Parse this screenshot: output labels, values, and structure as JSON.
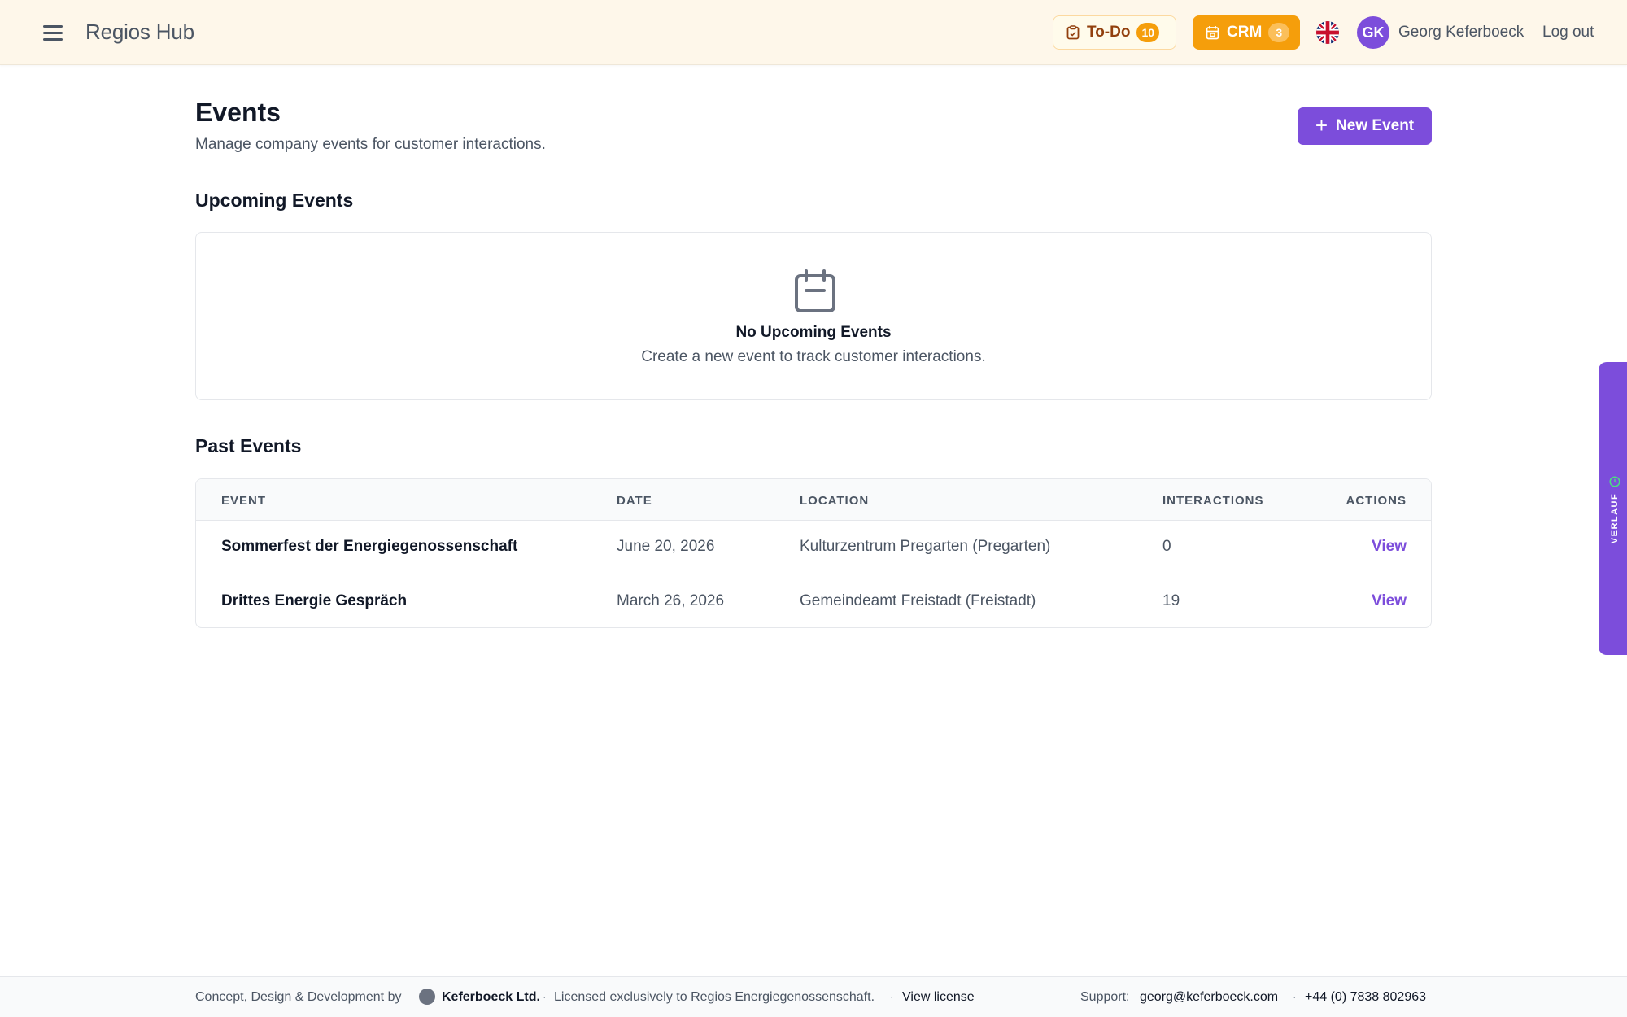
{
  "header": {
    "brand": "Regios Hub",
    "todo": {
      "label": "To-Do",
      "count": "10"
    },
    "crm": {
      "label": "CRM",
      "count": "3"
    },
    "language_icon": "uk-flag-icon",
    "user": {
      "initials": "GK",
      "name": "Georg Keferboeck"
    },
    "logout_label": "Log out"
  },
  "page": {
    "title": "Events",
    "subtitle": "Manage company events for customer interactions.",
    "new_event_label": "New Event"
  },
  "upcoming": {
    "title": "Upcoming Events",
    "empty_title": "No Upcoming Events",
    "empty_text": "Create a new event to track customer interactions."
  },
  "past": {
    "title": "Past Events",
    "columns": [
      "EVENT",
      "DATE",
      "LOCATION",
      "INTERACTIONS",
      "ACTIONS"
    ],
    "rows": [
      {
        "event": "Sommerfest der Energiegenossenschaft",
        "date": "June 20, 2026",
        "location": "Kulturzentrum Pregarten (Pregarten)",
        "interactions": "0",
        "action": "View"
      },
      {
        "event": "Drittes Energie Gespräch",
        "date": "March 26, 2026",
        "location": "Gemeindeamt Freistadt (Freistadt)",
        "interactions": "19",
        "action": "View"
      }
    ]
  },
  "side_tab": {
    "label": "VERLAUF"
  },
  "footer": {
    "credit_prefix": "Concept, Design & Development by",
    "company": "Keferboeck Ltd.",
    "license_text": "Licensed exclusively to Regios Energiegenossenschaft.",
    "view_license": "View license",
    "support_label": "Support:",
    "support_email": "georg@keferboeck.com",
    "phone": "+44 (0) 7838 802963"
  },
  "colors": {
    "accent": "#7c4ddb",
    "crm": "#f59e0b",
    "header_bg": "#fef7ea"
  }
}
